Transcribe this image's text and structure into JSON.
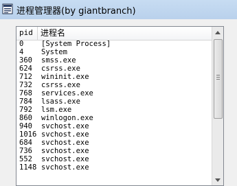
{
  "window": {
    "title": "进程管理器(by giantbranch)"
  },
  "icons": {
    "app": "app-icon",
    "scroll_up": "chevron-up-icon",
    "scroll_down": "chevron-down-icon"
  },
  "table": {
    "columns": [
      "pid",
      "进程名"
    ],
    "rows": [
      {
        "pid": "0",
        "name": "[System Process]"
      },
      {
        "pid": "4",
        "name": "System"
      },
      {
        "pid": "360",
        "name": "smss.exe"
      },
      {
        "pid": "624",
        "name": "csrss.exe"
      },
      {
        "pid": "712",
        "name": "wininit.exe"
      },
      {
        "pid": "732",
        "name": "csrss.exe"
      },
      {
        "pid": "768",
        "name": "services.exe"
      },
      {
        "pid": "784",
        "name": "lsass.exe"
      },
      {
        "pid": "792",
        "name": "lsm.exe"
      },
      {
        "pid": "860",
        "name": "winlogon.exe"
      },
      {
        "pid": "940",
        "name": "svchost.exe"
      },
      {
        "pid": "1016",
        "name": "svchost.exe"
      },
      {
        "pid": "684",
        "name": "svchost.exe"
      },
      {
        "pid": "736",
        "name": "svchost.exe"
      },
      {
        "pid": "552",
        "name": "svchost.exe"
      },
      {
        "pid": "1148",
        "name": "svchost.exe"
      }
    ]
  }
}
